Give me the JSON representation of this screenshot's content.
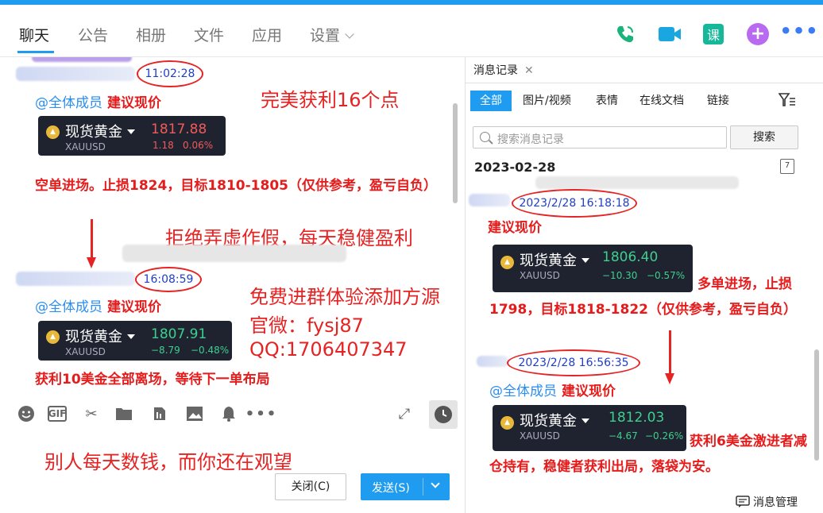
{
  "tabs": [
    {
      "label": "聊天"
    },
    {
      "label": "公告"
    },
    {
      "label": "相册"
    },
    {
      "label": "文件"
    },
    {
      "label": "应用"
    },
    {
      "label": "设置"
    }
  ],
  "top_icons": {
    "course_label": "课",
    "plus_label": "+",
    "more_label": "•••"
  },
  "chat": {
    "msg1": {
      "time": "11:02:28",
      "mention": "@全体成员",
      "title": "建议现价",
      "card": {
        "name": "现货黄金",
        "symbol": "XAUUSD",
        "price": "1817.88",
        "change": "1.18",
        "pct": "0.06%"
      },
      "text": "空单进场。止损1824，目标1810-1805（仅供参考，盈亏自负）"
    },
    "msg2": {
      "time": "16:08:59",
      "mention": "@全体成员",
      "title": "建议现价",
      "card": {
        "name": "现货黄金",
        "symbol": "XAUUSD",
        "price": "1807.91",
        "change": "−8.79",
        "pct": "−0.48%"
      },
      "text": "获利10美金全部离场，等待下一单布局"
    },
    "overlays": {
      "profit16": "完美获利16个点",
      "refuse": "拒绝弄虚作假，每天稳健盈利",
      "free": "免费进群体验添加方源",
      "wechat": "官微：fysj87",
      "qq": "QQ:1706407347",
      "watch": "别人每天数钱，而你还在观望"
    }
  },
  "buttons": {
    "close": "关闭(C)",
    "send": "发送(S)"
  },
  "history": {
    "tab_label": "消息记录",
    "filters": [
      "全部",
      "图片/视频",
      "表情",
      "在线文档",
      "链接"
    ],
    "search_placeholder": "搜索消息记录",
    "search_button": "搜索",
    "date": "2023-02-28",
    "calendar_label": "7",
    "msg1": {
      "time": "2023/2/28 16:18:18",
      "title": "建议现价",
      "card": {
        "name": "现货黄金",
        "symbol": "XAUUSD",
        "price": "1806.40",
        "change": "−10.30",
        "pct": "−0.57%"
      },
      "text": "多单进场，止损1798，目标1818-1822（仅供参考，盈亏自负）"
    },
    "msg2": {
      "time": "2023/2/28 16:56:35",
      "mention": "@全体成员",
      "title": "建议现价",
      "card": {
        "name": "现货黄金",
        "symbol": "XAUUSD",
        "price": "1812.03",
        "change": "−4.67",
        "pct": "−0.26%"
      },
      "text": "获利6美金激进者减仓持有，稳健者获利出局，落袋为安。"
    },
    "footer": "消息管理"
  },
  "colors": {
    "accent": "#1f9cf0",
    "alert_red": "#e61c1c",
    "card_bg": "#1f2330",
    "up_red": "#f05a5a",
    "down_green": "#3ecf8e"
  }
}
